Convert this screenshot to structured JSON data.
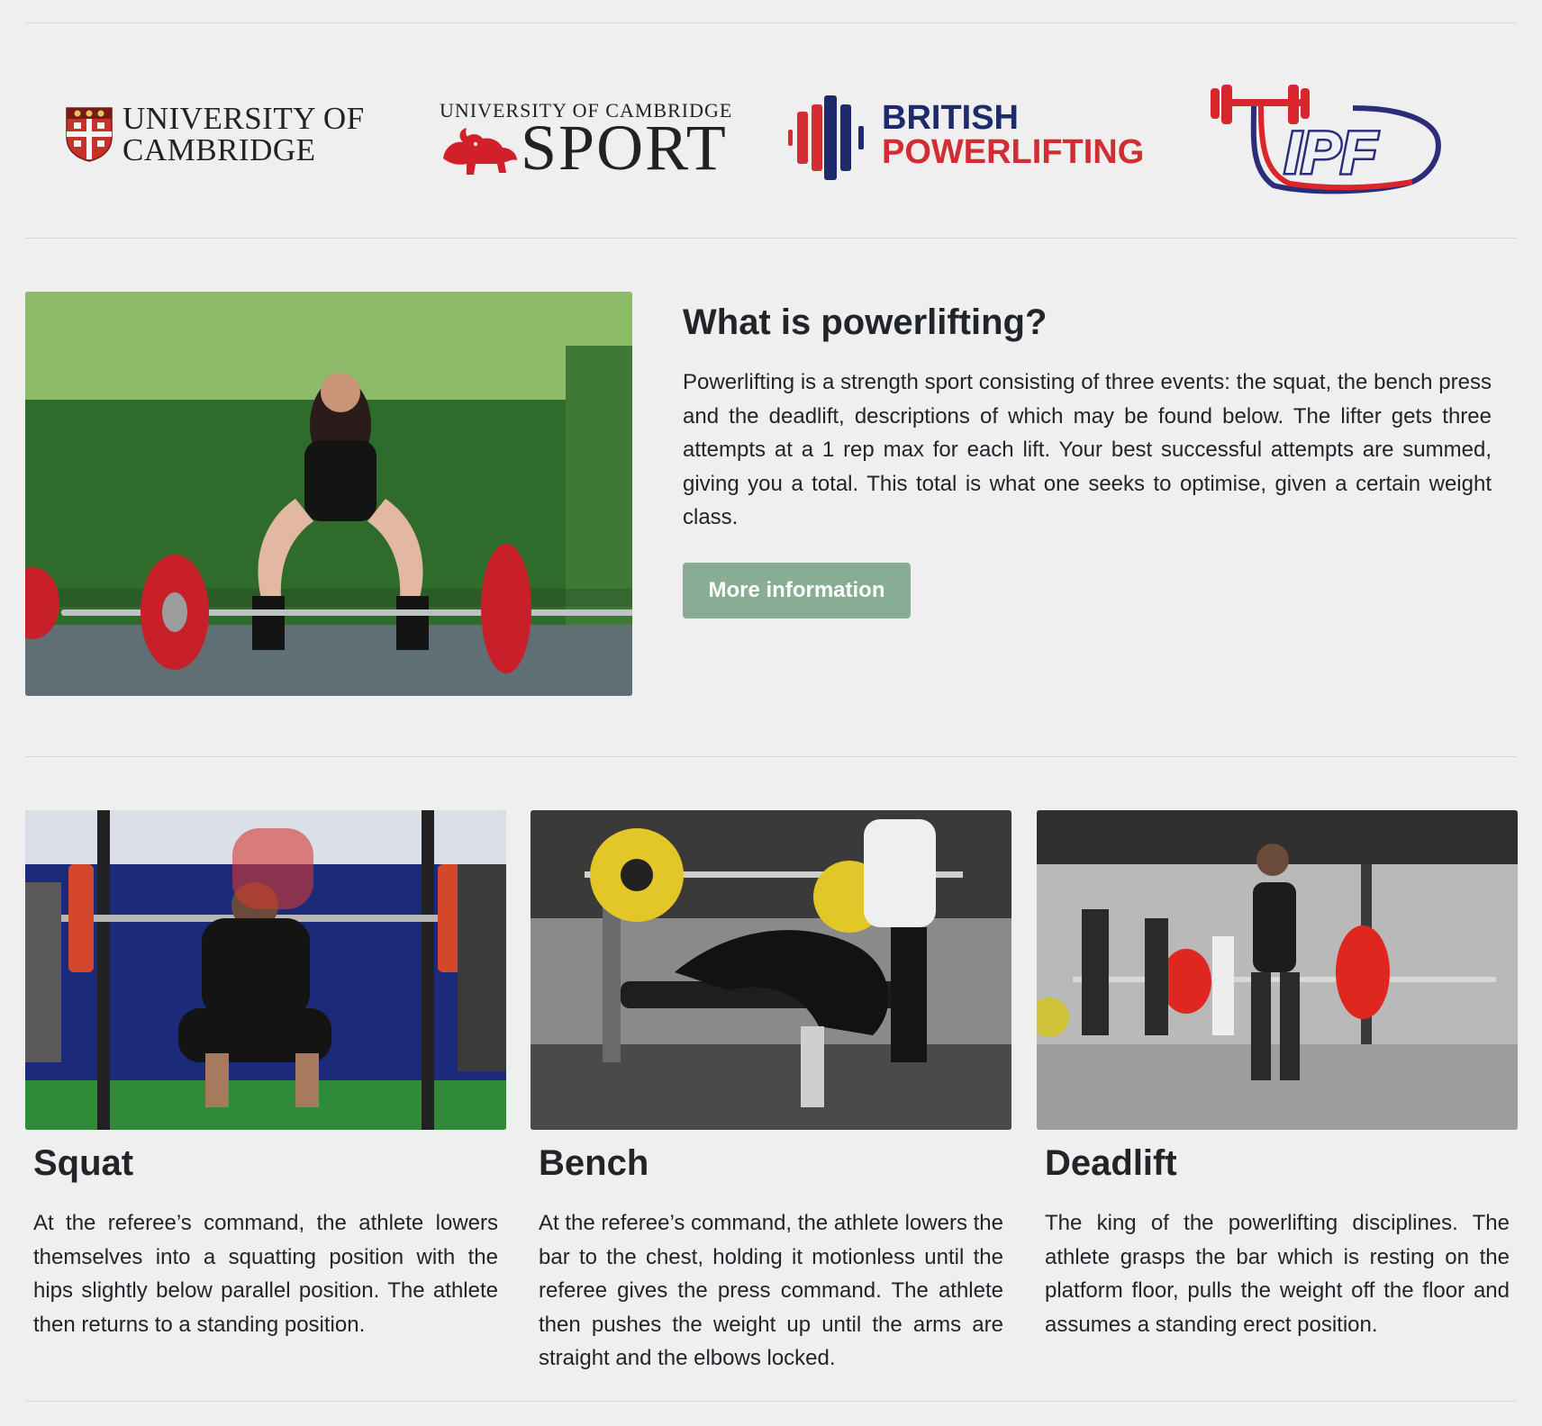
{
  "logos": {
    "cambridge": {
      "line1": "UNIVERSITY OF",
      "line2": "CAMBRIDGE"
    },
    "sport": {
      "top": "UNIVERSITY OF CAMBRIDGE",
      "main": "SPORT"
    },
    "british_powerlifting": {
      "line1": "BRITISH",
      "line2": "POWERLIFTING"
    },
    "ipf": {
      "text": "IPF"
    }
  },
  "intro": {
    "title": "What is powerlifting?",
    "body": "Powerlifting is a strength sport consisting of three events: the squat, the bench press and the deadlift, descriptions of which may be found below. The lifter gets three attempts at a 1 rep max for each lift. Your best successful attempts are summed, giving you a total. This total is what one seeks to optimise, given a certain weight class.",
    "button_label": "More information"
  },
  "lifts": [
    {
      "title": "Squat",
      "body": "At the referee’s command, the athlete lowers themselves into a squatting position with the hips slightly below parallel position. The athlete then returns to a standing position."
    },
    {
      "title": "Bench",
      "body": "At the referee’s command, the athlete lowers the bar to the chest, holding it motionless until the referee gives the press command. The athlete then pushes the weight up until the arms are straight and the elbows locked."
    },
    {
      "title": "Deadlift",
      "body": "The king of the powerlifting disciplines. The athlete grasps the bar which is resting on the platform floor, pulls the weight off the floor and assumes a standing erect position."
    }
  ],
  "colors": {
    "background": "#efefef",
    "button": "#88ad94",
    "bp_navy": "#1d2a6b",
    "bp_red": "#d22d33",
    "ipf_navy": "#2b2d7a",
    "ipf_red": "#d9262c"
  }
}
